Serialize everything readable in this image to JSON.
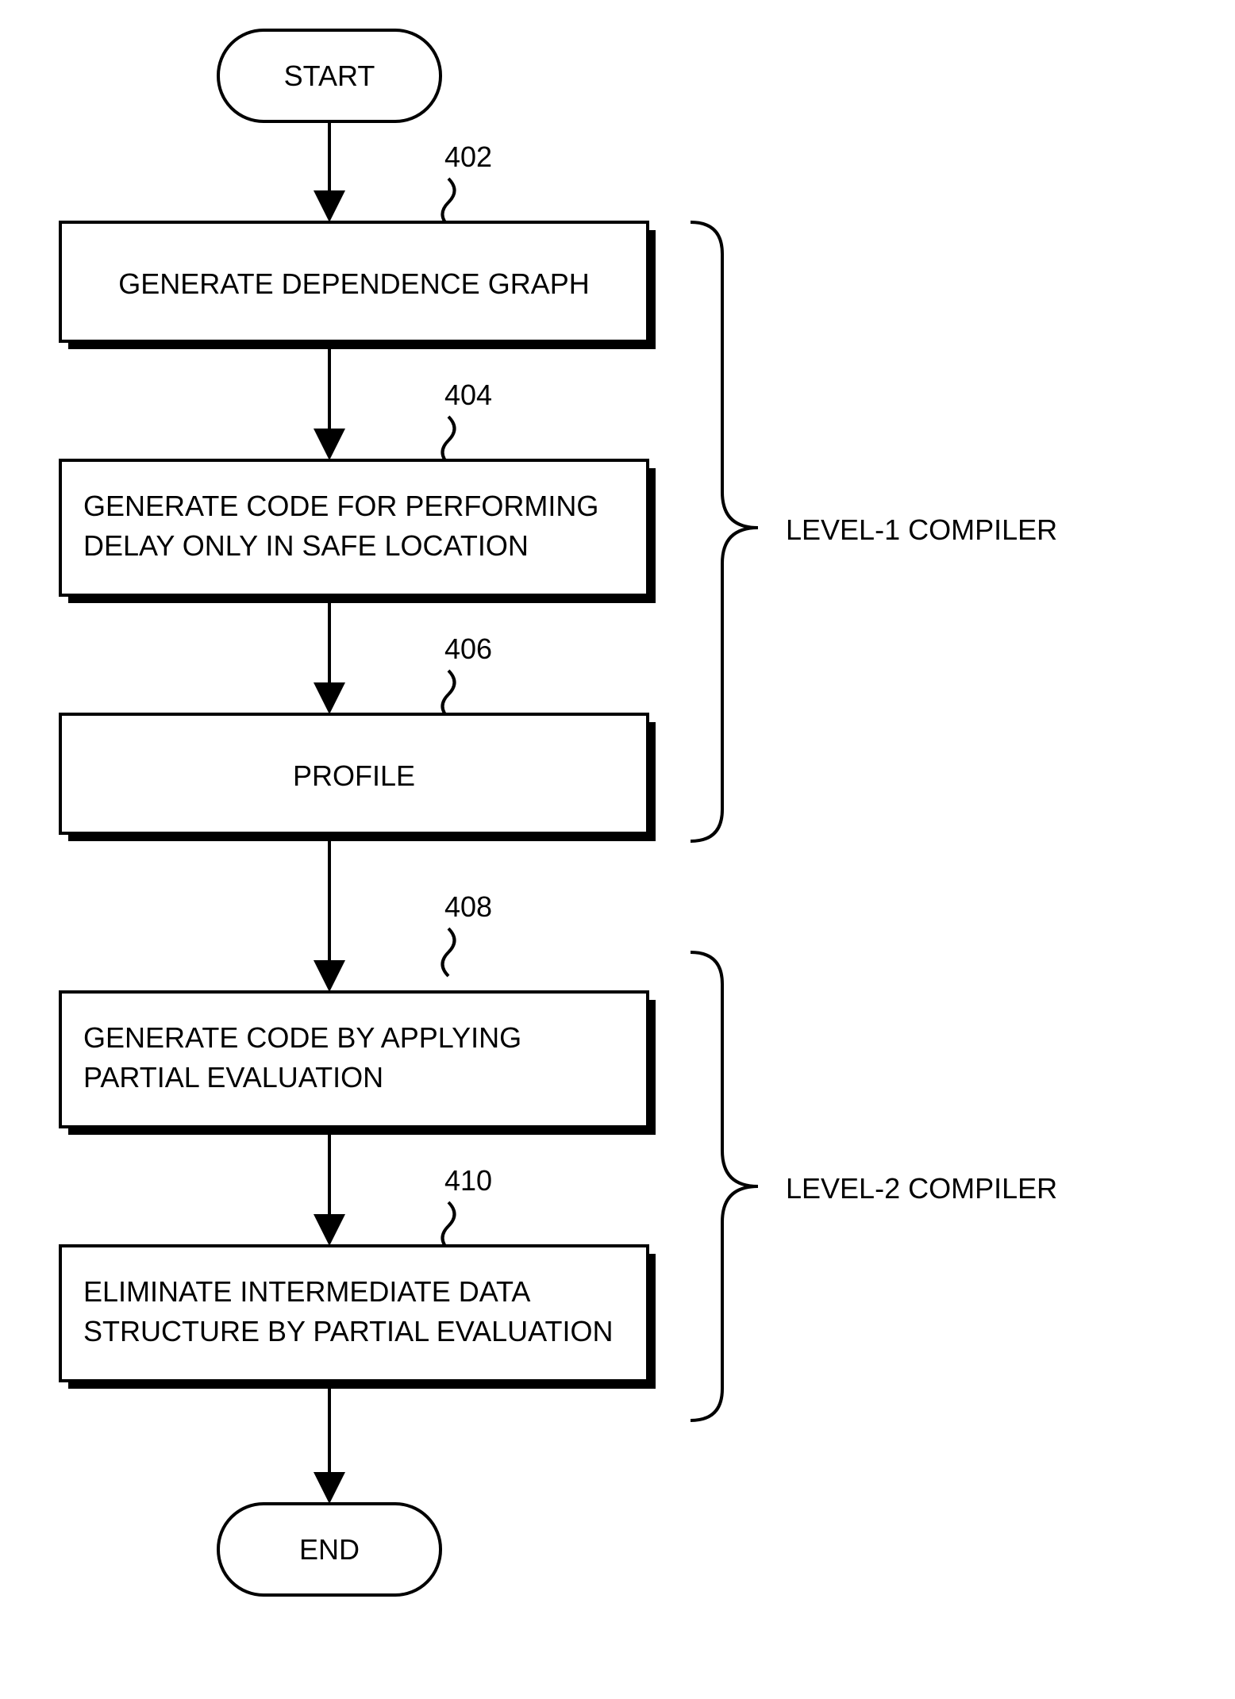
{
  "start": "START",
  "end": "END",
  "refs": {
    "r402": "402",
    "r404": "404",
    "r406": "406",
    "r408": "408",
    "r410": "410"
  },
  "steps": {
    "s402": "GENERATE DEPENDENCE GRAPH",
    "s404_l1": "GENERATE CODE FOR PERFORMING",
    "s404_l2": "DELAY ONLY IN SAFE LOCATION",
    "s406": "PROFILE",
    "s408_l1": "GENERATE CODE BY APPLYING",
    "s408_l2": "PARTIAL EVALUATION",
    "s410_l1": "ELIMINATE INTERMEDIATE DATA",
    "s410_l2": "STRUCTURE BY PARTIAL EVALUATION"
  },
  "groups": {
    "level1": "LEVEL-1 COMPILER",
    "level2": "LEVEL-2 COMPILER"
  }
}
